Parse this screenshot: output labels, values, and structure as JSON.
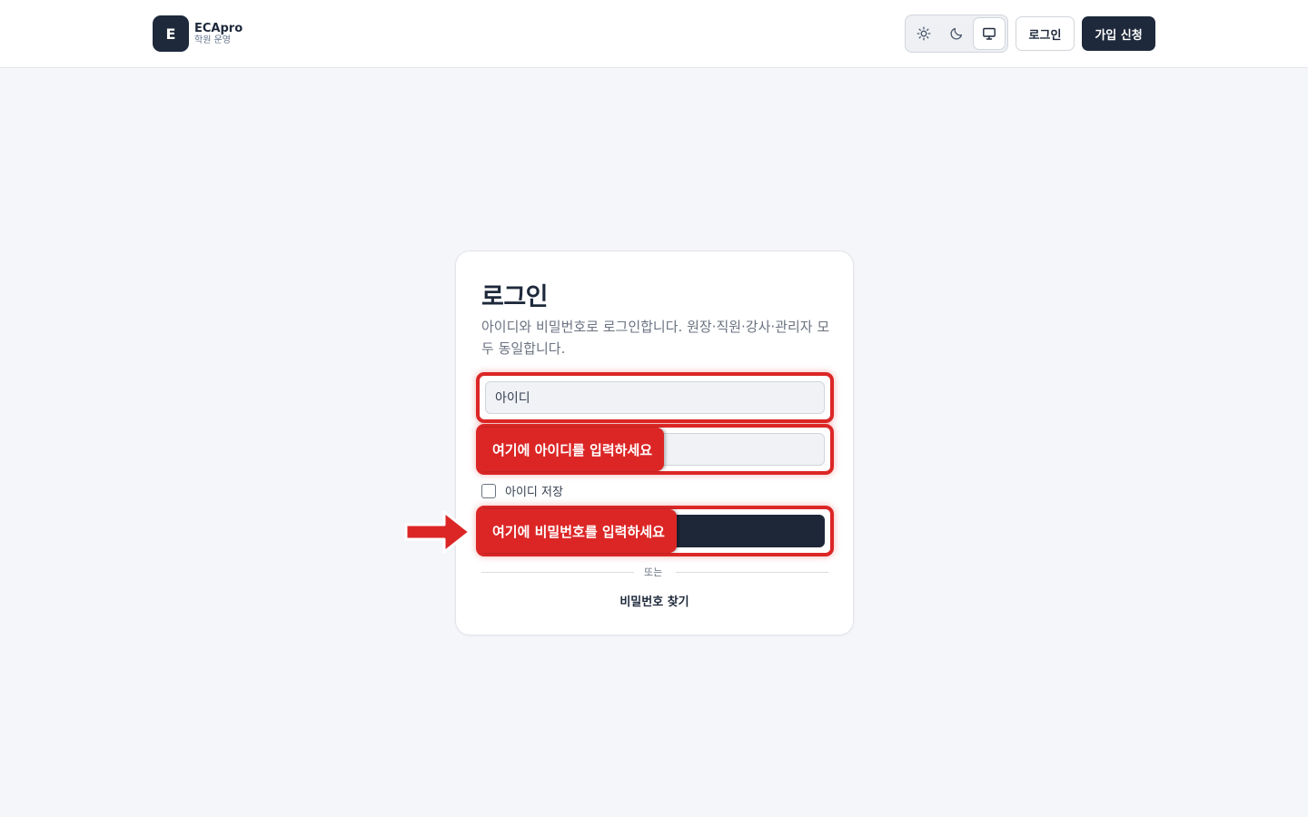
{
  "header": {
    "brand_initial": "E",
    "brand_name": "ECApro",
    "brand_sub": "학원 운영",
    "theme_options": [
      "light",
      "dark",
      "system"
    ],
    "theme_selected": "system",
    "login_label": "로그인",
    "signup_label": "가입 신청"
  },
  "card": {
    "title": "로그인",
    "description": "아이디와 비밀번호로 로그인합니다. 원장·직원·강사·관리자 모두 동일합니다.",
    "id_placeholder": "아이디",
    "id_annotation": "여기에 아이디를 입력하세요",
    "password_annotation": "여기에 비밀번호를 입력하세요",
    "remember_label": "아이디 저장",
    "remember_checked": false,
    "divider_label": "또는",
    "forgot_label": "비밀번호 찾기"
  },
  "colors": {
    "primary": "#1e293b",
    "annotation": "#dc2626",
    "background": "#f5f6fa"
  }
}
